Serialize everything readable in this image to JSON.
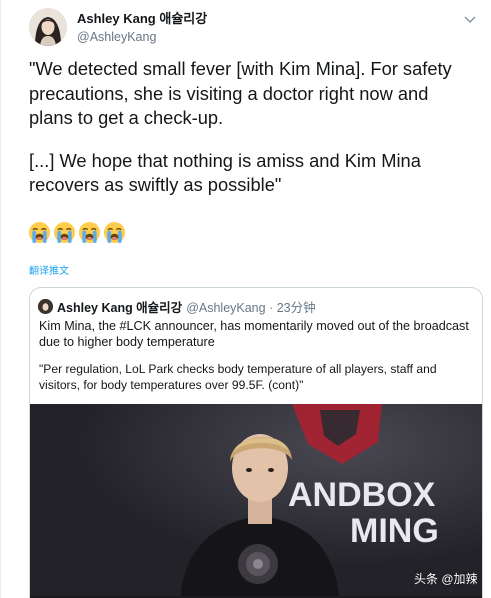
{
  "tweet": {
    "display_name": "Ashley Kang 애슐리강",
    "handle": "@AshleyKang",
    "paragraph_1": "\"We detected small fever [with Kim Mina]. For safety precautions, she is visiting a doctor right now and plans to get a check-up.",
    "paragraph_2": "[...] We hope that nothing is amiss and Kim Mina recovers as swiftly as possible\"",
    "emoji_count": 4,
    "emoji_name": "loudly-crying-face",
    "translate_label": "翻译推文"
  },
  "quoted_tweet": {
    "display_name": "Ashley Kang 애슐리강",
    "meta": "@AshleyKang · 23分钟",
    "text_1": "Kim Mina, the #LCK announcer, has momentarily moved out of the broadcast due to higher body temperature",
    "text_2": "\"Per regulation, LoL Park checks body temperature of all players, staff and visitors, for body temperatures over 99.5F. (cont)\"",
    "image_overlay_text_1": "ANDBOX",
    "image_overlay_text_2": "MING"
  },
  "watermark": "头条 @加辣",
  "colors": {
    "link": "#1da1f2",
    "secondary_text": "#657786",
    "border": "#ccd6dd",
    "logo_red": "#b01e2e"
  },
  "icons": {
    "menu": "chevron-down-icon"
  }
}
